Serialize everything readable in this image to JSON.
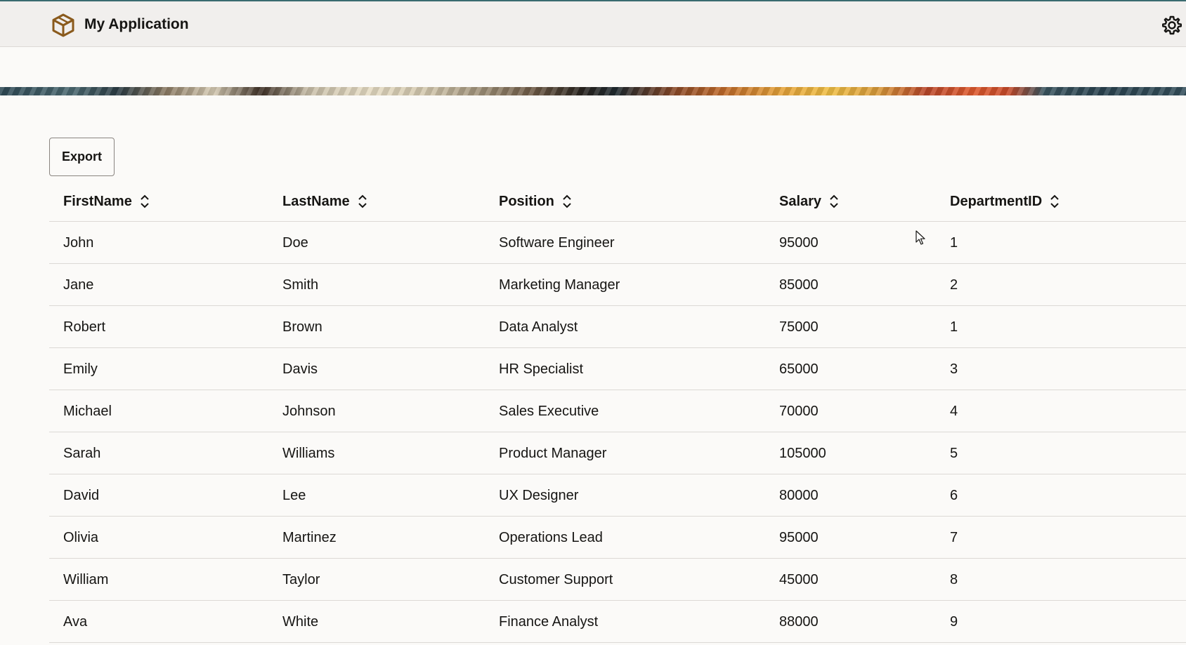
{
  "header": {
    "app_title": "My Application",
    "logo_icon": "cube-logo-icon",
    "settings_icon": "gear-icon",
    "accent_color": "#8a5a1c"
  },
  "toolbar": {
    "export_label": "Export"
  },
  "table": {
    "columns": [
      "FirstName",
      "LastName",
      "Position",
      "Salary",
      "DepartmentID"
    ],
    "sort_icon": "sort-up-down-icon",
    "rows": [
      [
        "John",
        "Doe",
        "Software Engineer",
        "95000",
        "1"
      ],
      [
        "Jane",
        "Smith",
        "Marketing Manager",
        "85000",
        "2"
      ],
      [
        "Robert",
        "Brown",
        "Data Analyst",
        "75000",
        "1"
      ],
      [
        "Emily",
        "Davis",
        "HR Specialist",
        "65000",
        "3"
      ],
      [
        "Michael",
        "Johnson",
        "Sales Executive",
        "70000",
        "4"
      ],
      [
        "Sarah",
        "Williams",
        "Product Manager",
        "105000",
        "5"
      ],
      [
        "David",
        "Lee",
        "UX Designer",
        "80000",
        "6"
      ],
      [
        "Olivia",
        "Martinez",
        "Operations Lead",
        "95000",
        "7"
      ],
      [
        "William",
        "Taylor",
        "Customer Support",
        "45000",
        "8"
      ],
      [
        "Ava",
        "White",
        "Finance Analyst",
        "88000",
        "9"
      ]
    ]
  }
}
